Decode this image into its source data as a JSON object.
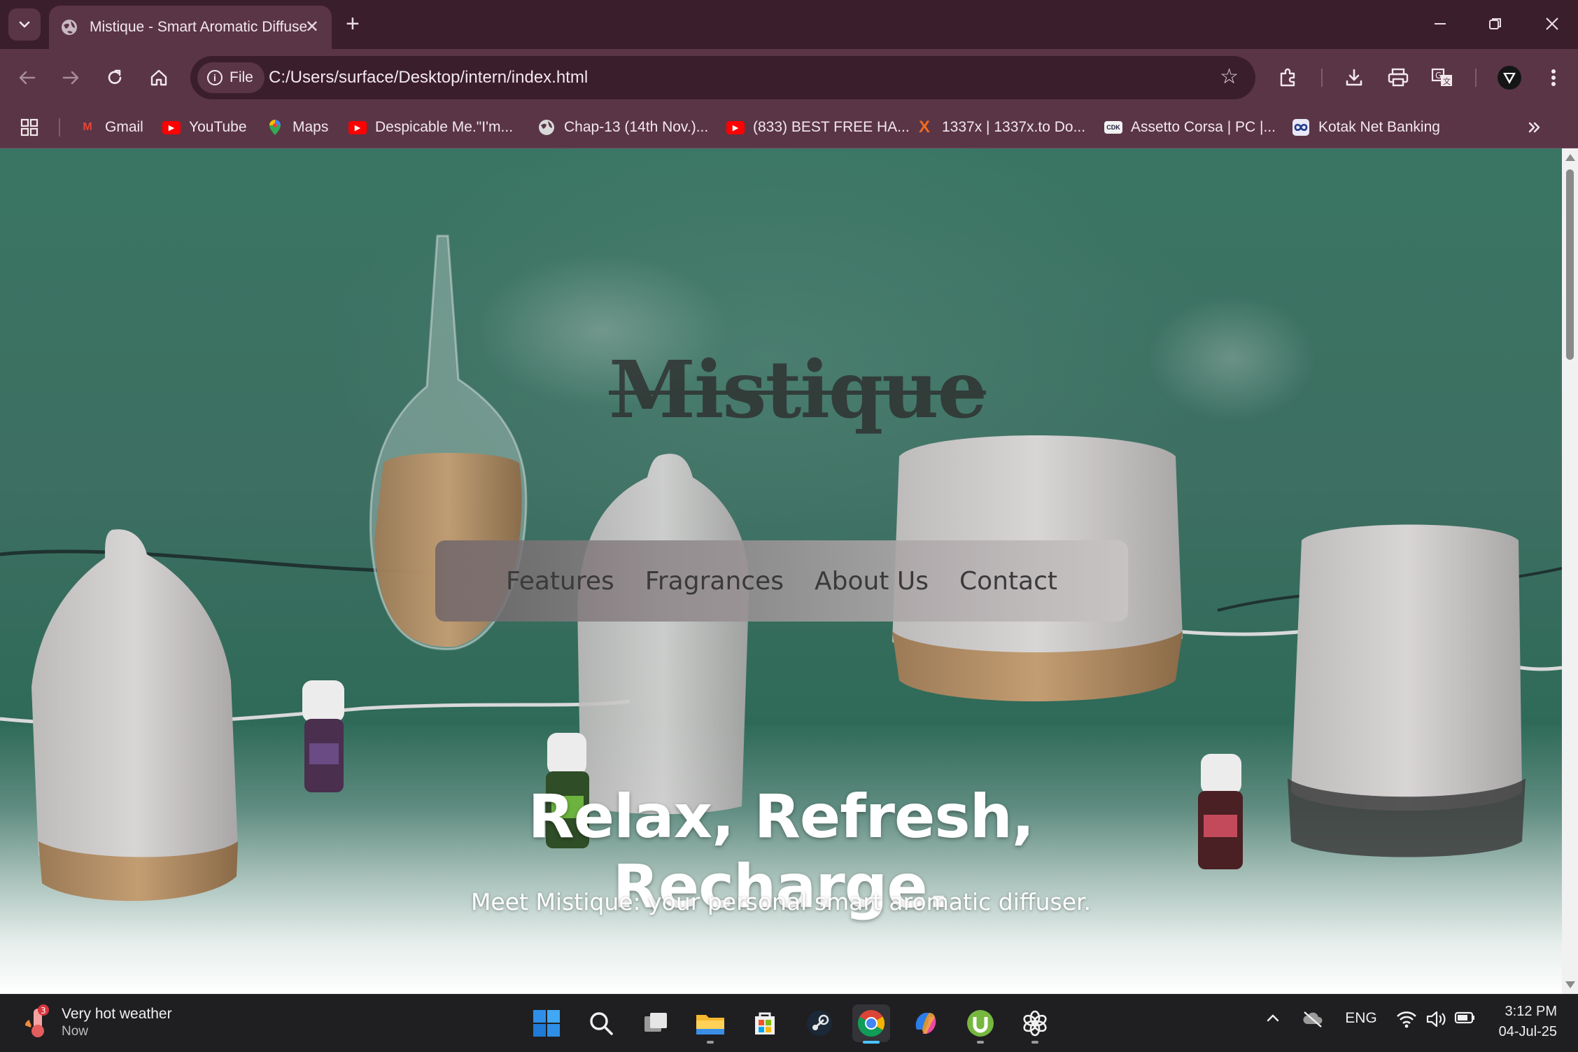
{
  "browser": {
    "tab_title": "Mistique - Smart Aromatic Diffuser",
    "close_glyph": "✕",
    "new_tab_glyph": "+",
    "chip_label": "File",
    "url": "C:/Users/surface/Desktop/intern/index.html",
    "window_controls": {
      "minimize": "—",
      "restore": "❐",
      "close": "✕"
    }
  },
  "bookmarks": [
    {
      "label": "Gmail",
      "icon": "gmail-icon",
      "glyph": "M",
      "color": "#ea4335"
    },
    {
      "label": "YouTube",
      "icon": "youtube-icon",
      "glyph": "▶",
      "color": "#ff0000"
    },
    {
      "label": "Maps",
      "icon": "maps-icon",
      "glyph": "⬤",
      "color": "#34a853"
    },
    {
      "label": "Despicable Me.\"I'm...",
      "icon": "youtube-icon",
      "glyph": "▶",
      "color": "#ff0000"
    },
    {
      "label": "Chap-13 (14th Nov.)...",
      "icon": "globe-icon",
      "glyph": "◍",
      "color": "#d9d9d9"
    },
    {
      "label": "(833) BEST FREE HA...",
      "icon": "youtube-icon",
      "glyph": "▶",
      "color": "#ff0000"
    },
    {
      "label": "1337x | 1337x.to Do...",
      "icon": "x-logo-icon",
      "glyph": "X",
      "color": "#f36a1d"
    },
    {
      "label": "Assetto Corsa | PC |...",
      "icon": "cdk-icon",
      "glyph": "CDK",
      "color": "#1d1d3a"
    },
    {
      "label": "Kotak Net Banking",
      "icon": "kotak-icon",
      "glyph": "∞",
      "color": "#e8e8f8"
    }
  ],
  "page": {
    "brand": "Mistique",
    "nav": [
      "Features",
      "Fragrances",
      "About Us",
      "Contact"
    ],
    "hero_title": "Relax, Refresh, Recharge.",
    "hero_subtitle": "Meet Mistique: your personal smart aromatic diffuser."
  },
  "taskbar": {
    "weather_title": "Very hot weather",
    "weather_sub": "Now",
    "weather_badge": "3",
    "lang": "ENG",
    "time": "3:12 PM",
    "date": "04-Jul-25",
    "apps": [
      "start",
      "search",
      "task-view",
      "file-explorer",
      "store",
      "steam",
      "chrome",
      "copilot",
      "utorrent",
      "chatgpt"
    ]
  },
  "colors": {
    "frame": "#3b1e2c",
    "toolbar": "#5a3546",
    "page_green": "#3a7563",
    "accent_active": "#4cc2ff"
  }
}
